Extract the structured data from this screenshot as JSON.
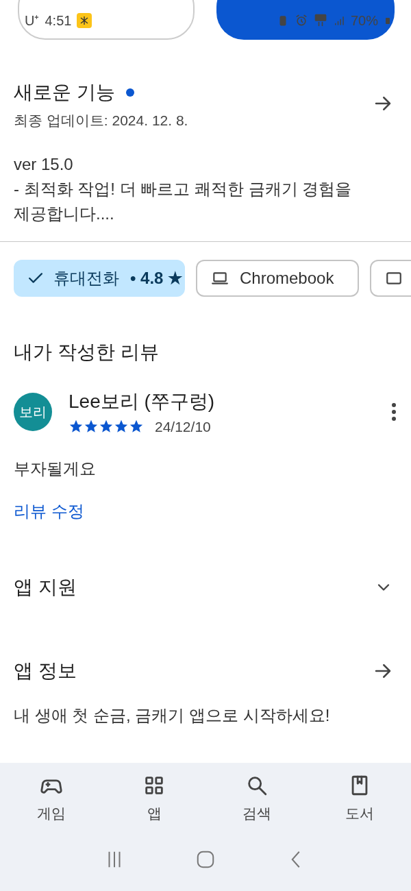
{
  "status_bar": {
    "carrier": "U⁺",
    "time": "4:51",
    "battery": "70%"
  },
  "whats_new": {
    "title": "새로운 기능",
    "updated": "최종 업데이트: 2024. 12. 8.",
    "version": "ver 15.0",
    "notes": "- 최적화 작업! 더 빠르고 쾌적한 금캐기 경험을 제공합니다...."
  },
  "device_chips": [
    {
      "kind": "phone",
      "label": "휴대전화",
      "rating": "• 4.8 ★",
      "selected": true
    },
    {
      "kind": "laptop",
      "label": "Chromebook",
      "selected": false
    },
    {
      "kind": "tablet",
      "selected": false
    }
  ],
  "my_review": {
    "title": "내가 작성한 리뷰",
    "avatar": "보리",
    "author": "Lee보리 (쭈구렁)",
    "stars": 5,
    "date": "24/12/10",
    "text": "부자될게요",
    "edit_link": "리뷰 수정"
  },
  "sections": [
    {
      "title": "앱 지원",
      "kind": "expand"
    },
    {
      "title": "앱 정보",
      "kind": "arrow",
      "description": "내 생애 첫 순금, 금캐기 앱으로 시작하세요!"
    }
  ],
  "bottom_nav": [
    {
      "kind": "games",
      "label": "게임"
    },
    {
      "kind": "apps",
      "label": "앱"
    },
    {
      "kind": "search",
      "label": "검색"
    },
    {
      "kind": "books",
      "label": "도서"
    }
  ]
}
